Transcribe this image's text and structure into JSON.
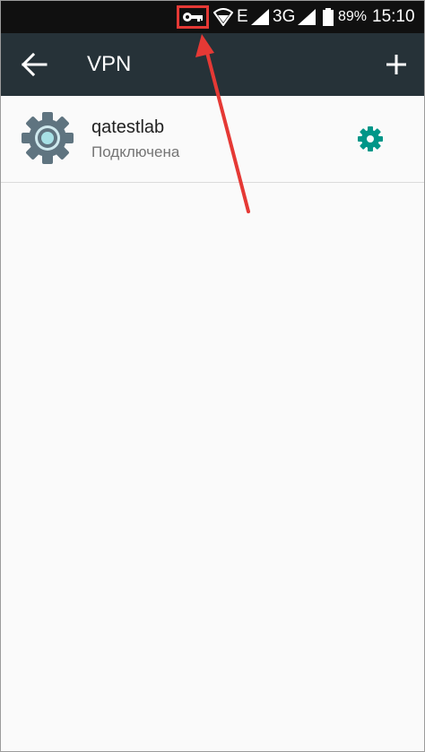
{
  "status_bar": {
    "network_type_e": "E",
    "network_type_3g": "3G",
    "battery": "89%",
    "time": "15:10",
    "icons": [
      "vpn-key-icon",
      "wifi-icon",
      "signal-icon",
      "signal-icon",
      "battery-icon"
    ]
  },
  "app_bar": {
    "title": "VPN",
    "back_icon": "arrow-back-icon",
    "add_icon": "add-icon"
  },
  "vpn_list": [
    {
      "name": "qatestlab",
      "status": "Подключена",
      "icon": "gear-icon",
      "settings_icon": "settings-icon"
    }
  ],
  "annotation": {
    "highlight_color": "#e53935"
  },
  "colors": {
    "app_bar": "#263238",
    "accent": "#009688",
    "status_bar": "#101010"
  }
}
